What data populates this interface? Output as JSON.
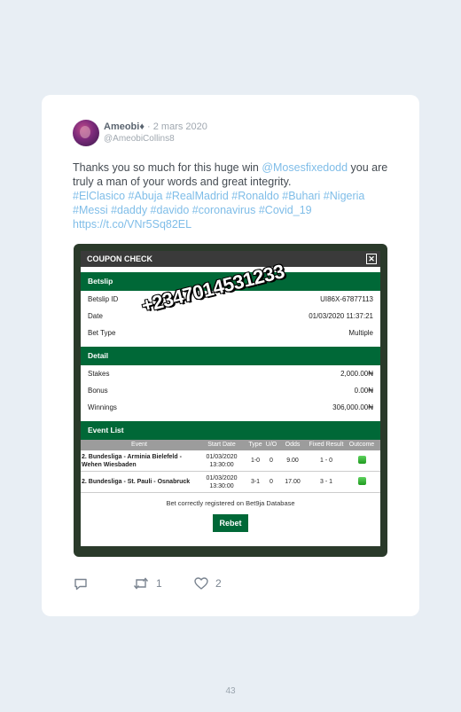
{
  "tweet": {
    "display_name": "Ameobi♦",
    "separator": "·",
    "date": "2 mars 2020",
    "handle": "@AmeobiCollins8",
    "text_part1": "Thanks you so much for this huge win ",
    "mention": "@Mosesfixedodd",
    "text_part2": " you are truly a man of your words and great integrity.",
    "hashtags": "#ElClasico #Abuja #RealMadrid #Ronaldo #Buhari #Nigeria #Messi #daddy #davido #coronavirus #Covid_19",
    "url": "https://t.co/VNr5Sq82EL"
  },
  "coupon": {
    "title": "COUPON CHECK",
    "close": "✕",
    "watermark": "+2347014531233",
    "betslip_header": "Betslip",
    "betslip_id_label": "Betslip ID",
    "betslip_id_value": "UI86X-67877113",
    "date_label": "Date",
    "date_value": "01/03/2020  11:37:21",
    "bet_type_label": "Bet Type",
    "bet_type_value": "Multiple",
    "detail_header": "Detail",
    "stakes_label": "Stakes",
    "stakes_value": "2,000.00₦",
    "bonus_label": "Bonus",
    "bonus_value": "0.00₦",
    "winnings_label": "Winnings",
    "winnings_value": "306,000.00₦",
    "event_list_header": "Event List",
    "columns": [
      "Event",
      "Start Date",
      "Type",
      "U/O",
      "Odds",
      "Fixed Result",
      "Outcome"
    ],
    "events": [
      {
        "event": "2. Bundesliga - Arminia Bielefeld - Wehen Wiesbaden",
        "start": "01/03/2020 13:30:00",
        "type": "1-0",
        "uo": "0",
        "odds": "9.00",
        "fixed_result": "1 - 0"
      },
      {
        "event": "2. Bundesliga - St. Pauli - Osnabruck",
        "start": "01/03/2020 13:30:00",
        "type": "3-1",
        "uo": "0",
        "odds": "17.00",
        "fixed_result": "3 - 1"
      }
    ],
    "registered_note": "Bet correctly registered on Bet9ja Database",
    "rebet_label": "Rebet"
  },
  "actions": {
    "reply_icon": "reply-icon",
    "retweet_icon": "retweet-icon",
    "retweet_count": "1",
    "like_icon": "heart-icon",
    "like_count": "2"
  },
  "page_number": "43",
  "colors": {
    "link": "#7fbde8",
    "bet9ja_green": "#006837",
    "page_bg": "#e8eef4"
  }
}
